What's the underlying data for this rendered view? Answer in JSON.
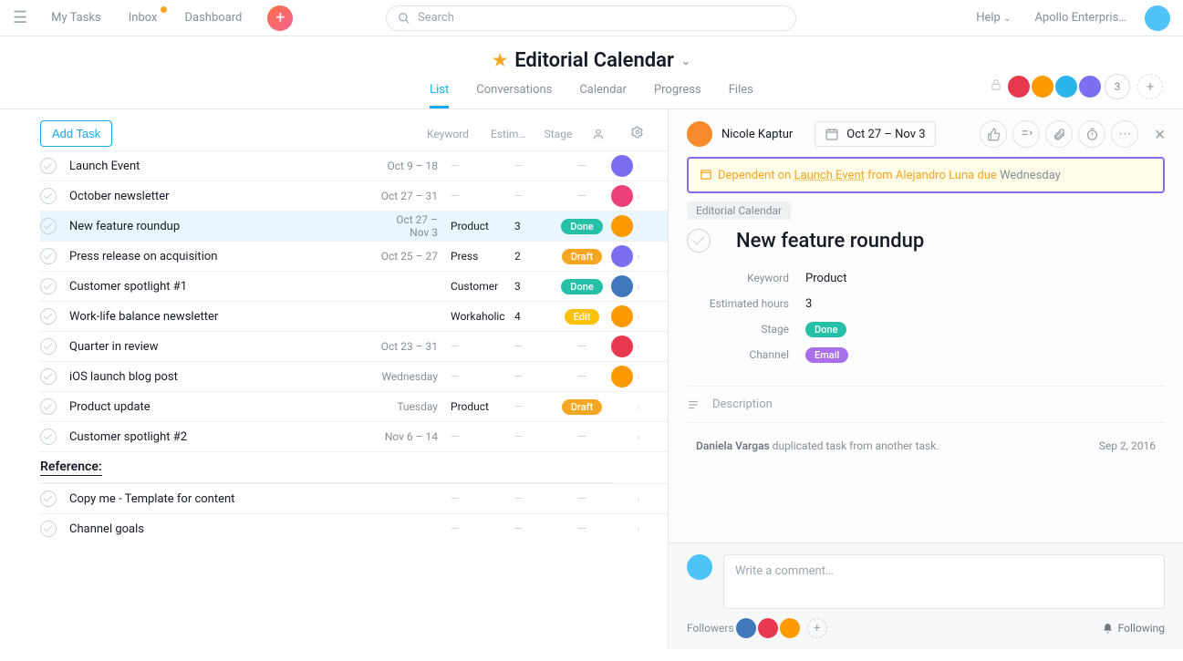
{
  "topnav": {
    "mytasks": "My Tasks",
    "inbox": "Inbox",
    "dashboard": "Dashboard",
    "search_placeholder": "Search",
    "help": "Help",
    "org": "Apollo Enterpris…"
  },
  "project": {
    "title": "Editorial Calendar",
    "extra_members": "3",
    "tabs": {
      "list": "List",
      "conversations": "Conversations",
      "calendar": "Calendar",
      "progress": "Progress",
      "files": "Files"
    }
  },
  "list": {
    "add_task": "Add Task",
    "columns": {
      "keyword": "Keyword",
      "estim": "Estim…",
      "stage": "Stage"
    },
    "section": "Reference:",
    "tasks": [
      {
        "name": "Launch Event",
        "date": "Oct 9 – 18",
        "kw": "",
        "est": "",
        "stage": "",
        "av": "c-purple"
      },
      {
        "name": "October newsletter",
        "date": "Oct 27 – 31",
        "kw": "",
        "est": "",
        "stage": "",
        "av": "c-pink"
      },
      {
        "name": "New feature roundup",
        "date": "Oct 27 – Nov 3",
        "kw": "Product",
        "est": "3",
        "stage": "Done",
        "stage_class": "done",
        "av": "c-orange",
        "selected": true
      },
      {
        "name": "Press release on acquisition",
        "date": "Oct 25 – 27",
        "kw": "Press",
        "est": "2",
        "stage": "Draft",
        "stage_class": "draft",
        "av": "c-purple"
      },
      {
        "name": "Customer spotlight #1",
        "date": "",
        "kw": "Customer",
        "est": "3",
        "stage": "Done",
        "stage_class": "done",
        "av": "c-blue"
      },
      {
        "name": "Work-life balance newsletter",
        "date": "",
        "kw": "Workaholic",
        "est": "4",
        "stage": "Edit",
        "stage_class": "edit",
        "av": "c-orange"
      },
      {
        "name": "Quarter in review",
        "date": "Oct 23 – 31",
        "kw": "",
        "est": "",
        "stage": "",
        "av": "c-red"
      },
      {
        "name": "iOS launch blog post",
        "date": "Wednesday",
        "kw": "",
        "est": "",
        "stage": "",
        "av": "c-orange"
      },
      {
        "name": "Product update",
        "date": "Tuesday",
        "kw": "Product",
        "est": "",
        "stage": "Draft",
        "stage_class": "draft",
        "av": ""
      },
      {
        "name": "Customer spotlight #2",
        "date": "Nov 6 – 14",
        "kw": "",
        "est": "",
        "stage": "",
        "av": ""
      }
    ],
    "reference": [
      {
        "name": "Copy me - Template for content"
      },
      {
        "name": "Channel goals"
      }
    ]
  },
  "detail": {
    "assignee": "Nicole Kaptur",
    "date": "Oct 27 – Nov 3",
    "dependency": {
      "prefix": "Dependent on ",
      "task": "Launch Event",
      "from": " from Alejandro Luna due ",
      "due": "Wednesday"
    },
    "breadcrumb": "Editorial Calendar",
    "title": "New feature roundup",
    "fields": {
      "keyword_label": "Keyword",
      "keyword_value": "Product",
      "hours_label": "Estimated hours",
      "hours_value": "3",
      "stage_label": "Stage",
      "stage_value": "Done",
      "channel_label": "Channel",
      "channel_value": "Email"
    },
    "description_placeholder": "Description",
    "activity": {
      "actor": "Daniela Vargas",
      "text": " duplicated task from another task.",
      "date": "Sep 2, 2016"
    },
    "comment_placeholder": "Write a comment…",
    "followers_label": "Followers",
    "following_label": "Following"
  }
}
